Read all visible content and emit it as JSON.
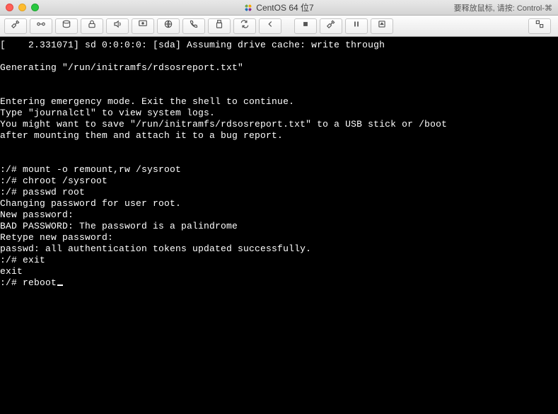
{
  "window": {
    "title": "CentOS 64 位7",
    "release_hint": "要释放鼠标, 请按: Control-⌘"
  },
  "toolbar": {
    "buttons_left": [
      "wrench",
      "connection",
      "harddisk",
      "lock",
      "volume",
      "display",
      "network",
      "phone",
      "usb",
      "loop",
      "back"
    ],
    "buttons_mid": [
      "stop",
      "wrench2",
      "pause",
      "eject"
    ],
    "buttons_right": [
      "expand"
    ]
  },
  "terminal": {
    "lines": [
      "[    2.331071] sd 0:0:0:0: [sda] Assuming drive cache: write through",
      "",
      "Generating \"/run/initramfs/rdsosreport.txt\"",
      "",
      "",
      "Entering emergency mode. Exit the shell to continue.",
      "Type \"journalctl\" to view system logs.",
      "You might want to save \"/run/initramfs/rdsosreport.txt\" to a USB stick or /boot",
      "after mounting them and attach it to a bug report.",
      "",
      "",
      ":/# mount -o remount,rw /sysroot",
      ":/# chroot /sysroot",
      ":/# passwd root",
      "Changing password for user root.",
      "New password:",
      "BAD PASSWORD: The password is a palindrome",
      "Retype new password:",
      "passwd: all authentication tokens updated successfully.",
      ":/# exit",
      "exit",
      ":/# reboot"
    ]
  }
}
